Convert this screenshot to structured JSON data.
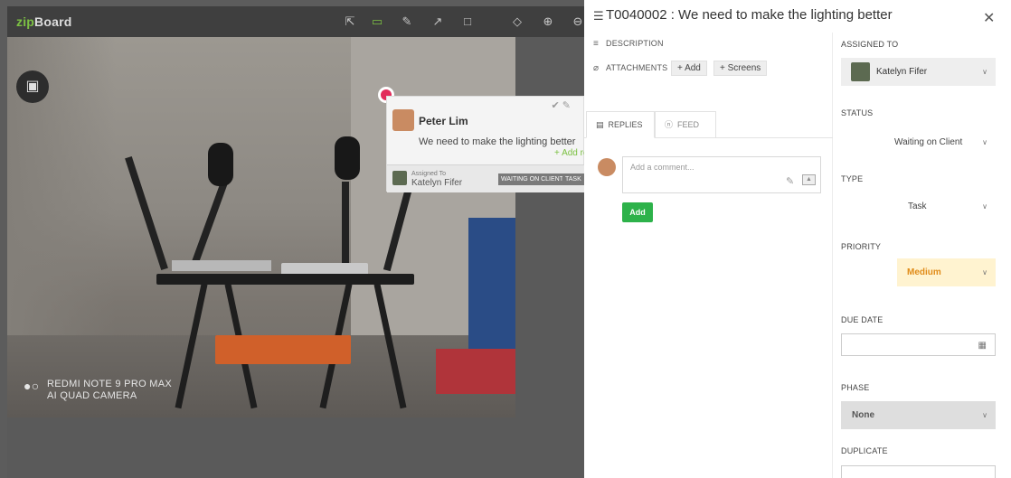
{
  "app": {
    "logo_prefix": "zip",
    "logo_suffix": "Board"
  },
  "toolbar": {
    "tools": [
      {
        "icon": "pointer-icon",
        "glyph": "⇱"
      },
      {
        "icon": "comment-icon",
        "glyph": "▭"
      },
      {
        "icon": "pencil-icon",
        "glyph": "✎"
      },
      {
        "icon": "arrow-icon",
        "glyph": "↗"
      },
      {
        "icon": "rectangle-icon",
        "glyph": "□"
      },
      {
        "icon": "eraser-icon",
        "glyph": "◇"
      },
      {
        "icon": "zoom-in-icon",
        "glyph": "⊕"
      },
      {
        "icon": "zoom-out-icon",
        "glyph": "⊖"
      }
    ],
    "active_color": "#7cc143"
  },
  "photo": {
    "camera_watermark_line1": "REDMI NOTE 9 PRO MAX",
    "camera_watermark_line2": "AI QUAD CAMERA"
  },
  "popup": {
    "author": "Peter Lim",
    "message": "We need to make the lighting better",
    "add_reply": "+ Add re",
    "assigned_to_label": "Assigned To",
    "assigned_to_name": "Katelyn Fifer",
    "status_badge": "WAITING ON CLIENT",
    "type_badge": "TASK"
  },
  "task": {
    "title": "T0040002 : We need to make the lighting better",
    "description_label": "DESCRIPTION",
    "attachments_label": "ATTACHMENTS",
    "add_attachment_label": "+ Add",
    "screens_label": "+ Screens"
  },
  "tabs": {
    "replies": "REPLIES",
    "feed": "FEED"
  },
  "comment": {
    "placeholder": "Add a comment...",
    "add_button": "Add"
  },
  "sidebar": {
    "assigned_to_label": "ASSIGNED TO",
    "assignee_name": "Katelyn Fifer",
    "status_label": "STATUS",
    "status_value": "Waiting on Client",
    "type_label": "TYPE",
    "type_value": "Task",
    "priority_label": "PRIORITY",
    "priority_value": "Medium",
    "priority_color": "#e08b18",
    "due_date_label": "DUE DATE",
    "phase_label": "PHASE",
    "phase_value": "None",
    "duplicate_label": "DUPLICATE"
  },
  "colors": {
    "accent_green": "#2db24a",
    "pin": "#e22b5a"
  }
}
